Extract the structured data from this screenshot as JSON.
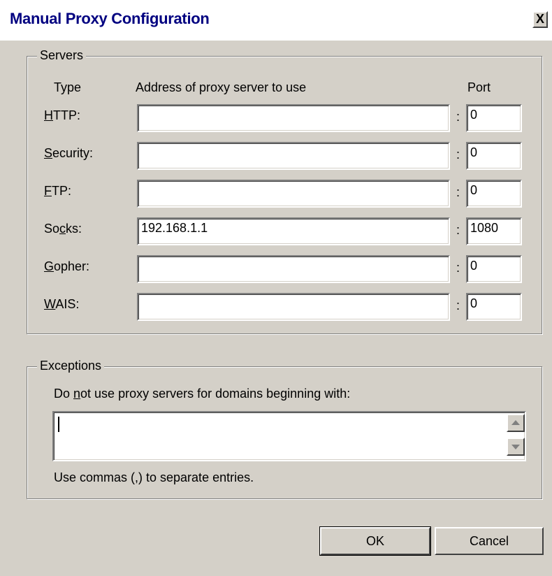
{
  "window": {
    "title": "Manual Proxy Configuration",
    "close_glyph": "X"
  },
  "servers": {
    "legend": "Servers",
    "col_type": "Type",
    "col_address": "Address of proxy server to use",
    "col_port": "Port",
    "rows": [
      {
        "label_pre": "",
        "label_key": "H",
        "label_post": "TTP:",
        "address": "",
        "port": "0"
      },
      {
        "label_pre": "",
        "label_key": "S",
        "label_post": "ecurity:",
        "address": "",
        "port": "0"
      },
      {
        "label_pre": "",
        "label_key": "F",
        "label_post": "TP:",
        "address": "",
        "port": "0"
      },
      {
        "label_pre": "So",
        "label_key": "c",
        "label_post": "ks:",
        "address": "192.168.1.1",
        "port": "1080"
      },
      {
        "label_pre": "",
        "label_key": "G",
        "label_post": "opher:",
        "address": "",
        "port": "0"
      },
      {
        "label_pre": "",
        "label_key": "W",
        "label_post": "AIS:",
        "address": "",
        "port": "0"
      }
    ],
    "separator": ":"
  },
  "exceptions": {
    "legend": "Exceptions",
    "prompt_pre": "Do ",
    "prompt_key": "n",
    "prompt_post": "ot use proxy servers for domains beginning with:",
    "value": "",
    "hint": "Use commas (,) to separate entries."
  },
  "buttons": {
    "ok": "OK",
    "cancel": "Cancel"
  }
}
